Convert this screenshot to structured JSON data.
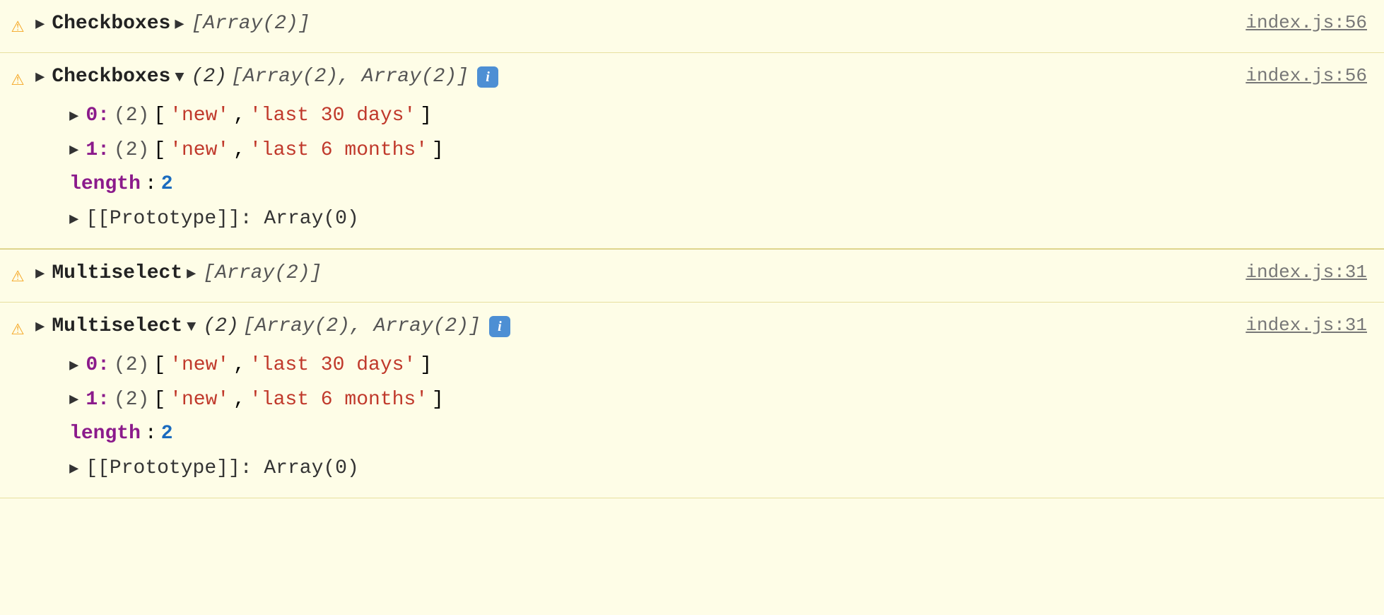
{
  "console": {
    "rows": [
      {
        "id": "row1",
        "type": "collapsed",
        "component": "Checkboxes",
        "arrayLabel": "[Array(2)]",
        "fileLink": "index.js:56",
        "expanded": false
      },
      {
        "id": "row2",
        "type": "expanded",
        "component": "Checkboxes",
        "count": "(2)",
        "arrayLabel": "[Array(2), Array(2)]",
        "hasInfoBadge": true,
        "fileLink": "index.js:56",
        "expanded": true,
        "items": [
          {
            "index": "0",
            "count": "(2)",
            "values": [
              "'new'",
              "'last 30 days'"
            ]
          },
          {
            "index": "1",
            "count": "(2)",
            "values": [
              "'new'",
              "'last 6 months'"
            ]
          }
        ],
        "length": "2",
        "prototype": "[[Prototype]]: Array(0)"
      },
      {
        "id": "row3",
        "type": "collapsed",
        "component": "Multiselect",
        "arrayLabel": "[Array(2)]",
        "fileLink": "index.js:31",
        "expanded": false
      },
      {
        "id": "row4",
        "type": "expanded",
        "component": "Multiselect",
        "count": "(2)",
        "arrayLabel": "[Array(2), Array(2)]",
        "hasInfoBadge": true,
        "fileLink": "index.js:31",
        "expanded": true,
        "items": [
          {
            "index": "0",
            "count": "(2)",
            "values": [
              "'new'",
              "'last 30 days'"
            ]
          },
          {
            "index": "1",
            "count": "(2)",
            "values": [
              "'new'",
              "'last 6 months'"
            ]
          }
        ],
        "length": "2",
        "prototype": "[[Prototype]]: Array(0)"
      }
    ]
  }
}
